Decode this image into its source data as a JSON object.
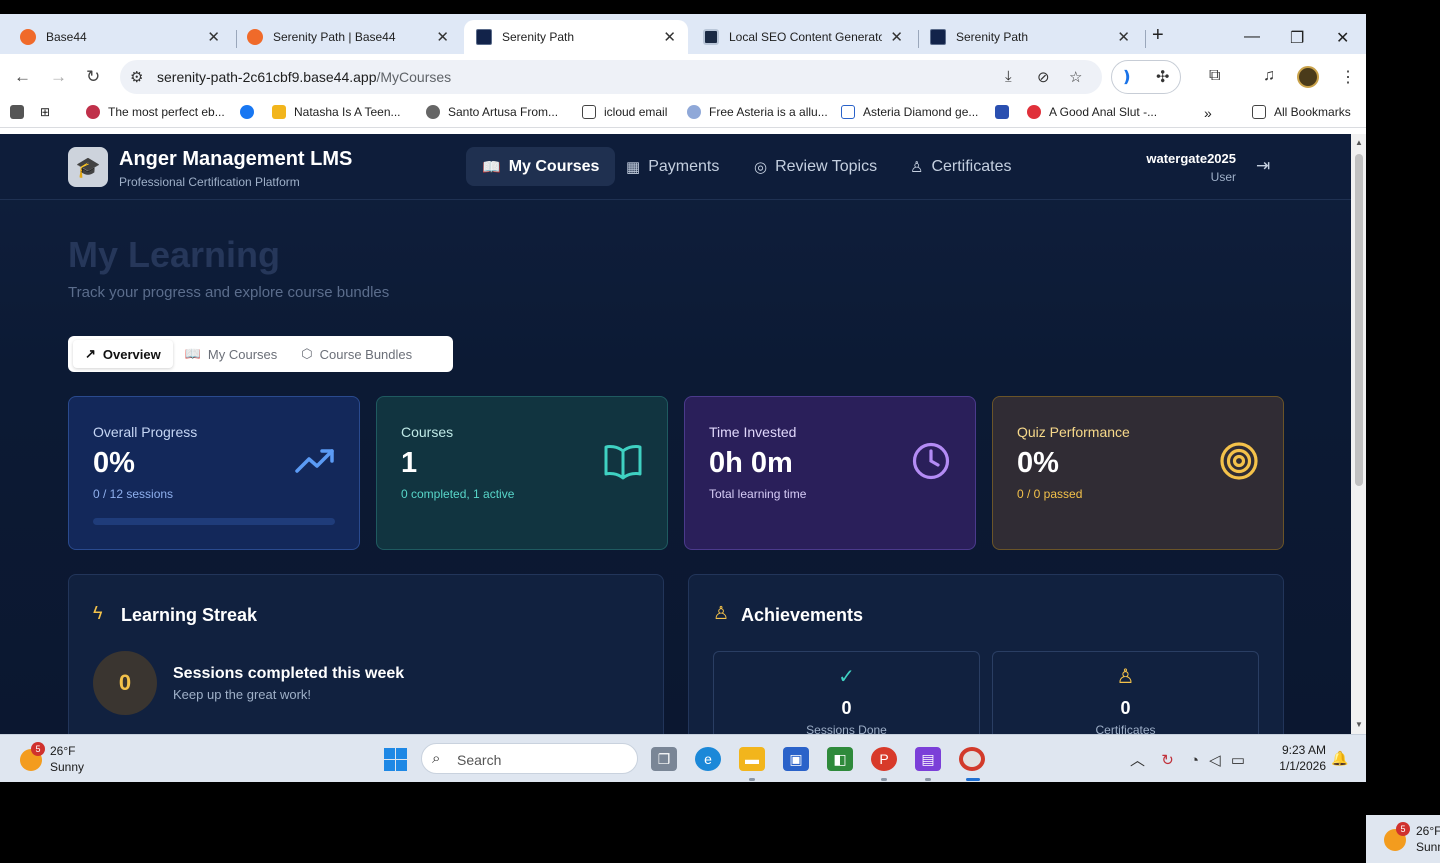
{
  "browser": {
    "tabs": [
      {
        "title": "Base44",
        "icon": "base44-favicon"
      },
      {
        "title": "Serenity Path | Base44",
        "icon": "base44-favicon"
      },
      {
        "title": "Serenity Path",
        "icon": "serenity-favicon",
        "active": true
      },
      {
        "title": "Local SEO Content Generator",
        "icon": "seo-favicon"
      },
      {
        "title": "Serenity Path",
        "icon": "serenity-favicon"
      }
    ],
    "url_host": "serenity-path-2c61cbf9.base44.app",
    "url_path": "/MyCourses",
    "bookmarks": [
      {
        "label": "The most perfect eb...",
        "icon": "heart-icon"
      },
      {
        "label": "",
        "icon": "facebook-icon"
      },
      {
        "label": "Natasha Is A Teen...",
        "icon": "w-icon"
      },
      {
        "label": "Santo Artusa From...",
        "icon": "globe-icon"
      },
      {
        "label": "icloud email",
        "icon": "folder-icon"
      },
      {
        "label": "Free Asteria is a allu...",
        "icon": "image-icon"
      },
      {
        "label": "Asteria Diamond ge...",
        "icon": "page-icon"
      },
      {
        "label": "",
        "icon": "app-icon"
      },
      {
        "label": "A Good Anal Slut -...",
        "icon": "site-icon"
      }
    ],
    "all_bookmarks": "All Bookmarks"
  },
  "app": {
    "brand": "Anger Management LMS",
    "brand_sub": "Professional Certification Platform",
    "nav": [
      {
        "label": "My Courses",
        "icon": "book-icon",
        "active": true
      },
      {
        "label": "Payments",
        "icon": "grid-icon"
      },
      {
        "label": "Review Topics",
        "icon": "target-icon"
      },
      {
        "label": "Certificates",
        "icon": "award-icon"
      }
    ],
    "user": {
      "name": "watergate2025",
      "role": "User"
    },
    "page_title": "My Learning",
    "page_subtitle": "Track your progress and explore course bundles",
    "subtabs": [
      {
        "label": "Overview",
        "icon": "trending-up-icon",
        "active": true
      },
      {
        "label": "My Courses",
        "icon": "book-icon"
      },
      {
        "label": "Course Bundles",
        "icon": "package-icon"
      }
    ],
    "stats": {
      "progress": {
        "label": "Overall Progress",
        "value": "0%",
        "sub": "0 / 12 sessions",
        "fraction": 0
      },
      "courses": {
        "label": "Courses",
        "value": "1",
        "sub": "0 completed, 1 active"
      },
      "time": {
        "label": "Time Invested",
        "value": "0h 0m",
        "sub": "Total learning time"
      },
      "quiz": {
        "label": "Quiz Performance",
        "value": "0%",
        "sub": "0 / 0 passed"
      }
    },
    "streak": {
      "title": "Learning Streak",
      "count": "0",
      "headline": "Sessions completed this week",
      "message": "Keep up the great work!"
    },
    "achievements": {
      "title": "Achievements",
      "items": [
        {
          "value": "0",
          "label": "Sessions Done",
          "icon": "check-circle-icon"
        },
        {
          "value": "0",
          "label": "Certificates",
          "icon": "award-icon"
        }
      ]
    }
  },
  "taskbar": {
    "weather_temp": "26°F",
    "weather_desc": "Sunny",
    "weather_badge": "5",
    "search_placeholder": "Search",
    "time": "9:23 AM",
    "date": "1/1/2026"
  },
  "second_monitor": {
    "weather_temp": "26°F",
    "weather_desc": "Sunn",
    "weather_badge": "5"
  }
}
